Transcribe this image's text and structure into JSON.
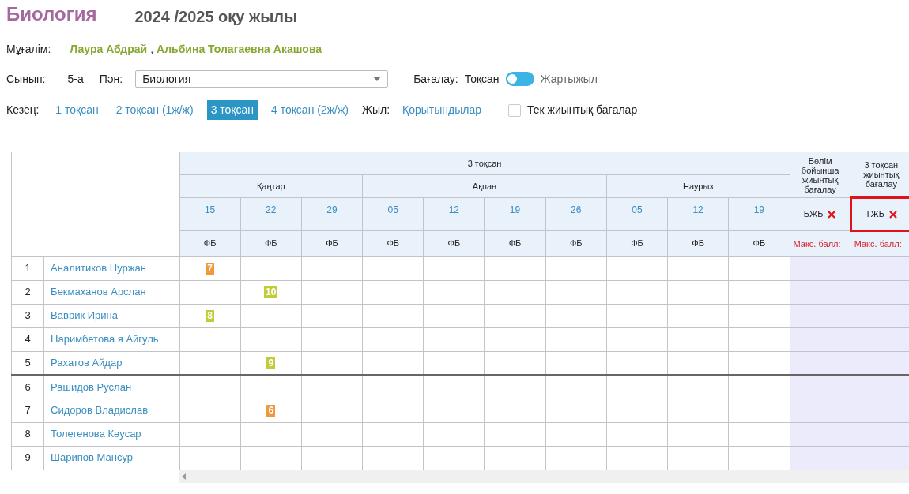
{
  "header": {
    "subject": "Биология",
    "year": "2024 /2025 оқу жылы"
  },
  "teacher": {
    "label": "Мұғалім:",
    "names": [
      "Лаура Абдрай",
      "Альбина Толагаевна Акашова"
    ],
    "separator": ","
  },
  "class": {
    "label": "Сынып:",
    "value": "5-а"
  },
  "subject_select": {
    "label": "Пән:",
    "value": "Биология"
  },
  "grading": {
    "label": "Бағалау:",
    "left": "Тоқсан",
    "right": "Жартыжыл",
    "on": false
  },
  "periods": {
    "label": "Кезең:",
    "items": [
      {
        "label": "1 тоқсан",
        "selected": false
      },
      {
        "label": "2 тоқсан (1ж/ж)",
        "selected": false
      },
      {
        "label": "3 тоқсан",
        "selected": true
      },
      {
        "label": "4 тоқсан (2ж/ж)",
        "selected": false
      }
    ],
    "year_label": "Жыл:",
    "year_link": "Қорытындылар",
    "summary_only": {
      "label": "Тек жиынтық бағалар",
      "checked": false
    }
  },
  "table": {
    "period": "3 тоқсан",
    "months": [
      {
        "name": "Қаңтар",
        "dates": [
          {
            "day": "15",
            "type": "ФБ"
          },
          {
            "day": "22",
            "type": "ФБ"
          },
          {
            "day": "29",
            "type": "ФБ"
          }
        ]
      },
      {
        "name": "Ақпан",
        "dates": [
          {
            "day": "05",
            "type": "ФБ"
          },
          {
            "day": "12",
            "type": "ФБ"
          },
          {
            "day": "19",
            "type": "ФБ"
          },
          {
            "day": "26",
            "type": "ФБ"
          }
        ]
      },
      {
        "name": "Наурыз",
        "dates": [
          {
            "day": "05",
            "type": "ФБ"
          },
          {
            "day": "12",
            "type": "ФБ"
          },
          {
            "day": "19",
            "type": "ФБ"
          }
        ]
      }
    ],
    "summatives": [
      {
        "title": "Бөлім бойынша жиынтық бағалау",
        "code": "БЖБ",
        "max": "Макс. балл:",
        "highlighted": false
      },
      {
        "title": "3 тоқсан жиынтық бағалау",
        "code": "ТЖБ",
        "max": "Макс. балл:",
        "highlighted": true
      }
    ],
    "rows": [
      {
        "num": "1",
        "name": "Аналитиков Нуржан",
        "divider_above": false,
        "cells": [
          {
            "mark": "7",
            "color": "#f0983c"
          },
          {},
          {},
          {},
          {},
          {},
          {},
          {},
          {},
          {}
        ]
      },
      {
        "num": "2",
        "name": "Бекмаханов Арслан",
        "divider_above": false,
        "cells": [
          {},
          {
            "mark": "10",
            "color": "#c2cc3a"
          },
          {},
          {},
          {},
          {},
          {},
          {},
          {},
          {}
        ]
      },
      {
        "num": "3",
        "name": "Ваврик Ирина",
        "divider_above": false,
        "cells": [
          {
            "mark": "8",
            "color": "#c2cc3a"
          },
          {},
          {},
          {},
          {},
          {},
          {},
          {},
          {},
          {}
        ]
      },
      {
        "num": "4",
        "name": "Наримбетова я Айгуль",
        "divider_above": false,
        "cells": [
          {},
          {},
          {},
          {},
          {},
          {},
          {},
          {},
          {},
          {}
        ]
      },
      {
        "num": "5",
        "name": "Рахатов Айдар",
        "divider_above": false,
        "cells": [
          {},
          {
            "mark": "9",
            "color": "#c2cc3a"
          },
          {},
          {},
          {},
          {},
          {},
          {},
          {},
          {}
        ]
      },
      {
        "num": "6",
        "name": "Рашидов Руслан",
        "divider_above": true,
        "cells": [
          {},
          {},
          {},
          {},
          {},
          {},
          {},
          {},
          {},
          {}
        ]
      },
      {
        "num": "7",
        "name": "Сидоров Владислав",
        "divider_above": false,
        "cells": [
          {},
          {
            "mark": "6",
            "color": "#f0983c"
          },
          {},
          {},
          {},
          {},
          {},
          {},
          {},
          {}
        ]
      },
      {
        "num": "8",
        "name": "Толегенова Кәусар",
        "divider_above": false,
        "cells": [
          {},
          {},
          {},
          {},
          {},
          {},
          {},
          {},
          {},
          {}
        ]
      },
      {
        "num": "9",
        "name": "Шарипов Мансур",
        "divider_above": false,
        "cells": [
          {},
          {},
          {},
          {},
          {},
          {},
          {},
          {},
          {},
          {}
        ]
      }
    ]
  }
}
